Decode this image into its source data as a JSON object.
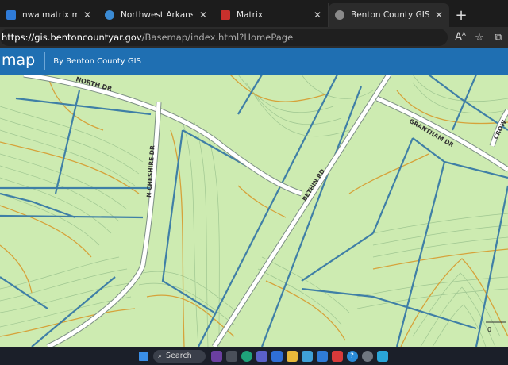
{
  "browser": {
    "tabs": [
      {
        "title": "nwa matrix mls - Search",
        "icon": "bing-search-icon",
        "color": "#2f7bd8"
      },
      {
        "title": "Northwest Arkansas Board",
        "icon": "site-icon",
        "color": "#3b8bd4"
      },
      {
        "title": "Matrix",
        "icon": "matrix-icon",
        "color": "#c9302c"
      },
      {
        "title": "Benton County GIS: Basem",
        "icon": "arcgis-icon",
        "color": "#8a8a8a"
      }
    ],
    "new_tab_label": "+",
    "close_label": "✕",
    "url_host": "https://gis.bentoncountyar.gov",
    "url_path": "/Basemap/index.html?HomePage"
  },
  "app_header": {
    "title": "map",
    "subtitle": "By Benton County GIS"
  },
  "map": {
    "roads": [
      {
        "label": "NORTH DR"
      },
      {
        "label": "N CHESHIRE DR"
      },
      {
        "label": "BETHIN RD"
      },
      {
        "label": "GRANTHAM DR"
      },
      {
        "label": "CROW"
      }
    ],
    "scale_label": "0",
    "colors": {
      "land": "#cdebb1",
      "parcel": "#3f7fa6",
      "contour_index": "#d6a23a",
      "contour": "#a8c79a",
      "road": "#ffffff"
    }
  },
  "taskbar": {
    "search_label": "Search"
  }
}
